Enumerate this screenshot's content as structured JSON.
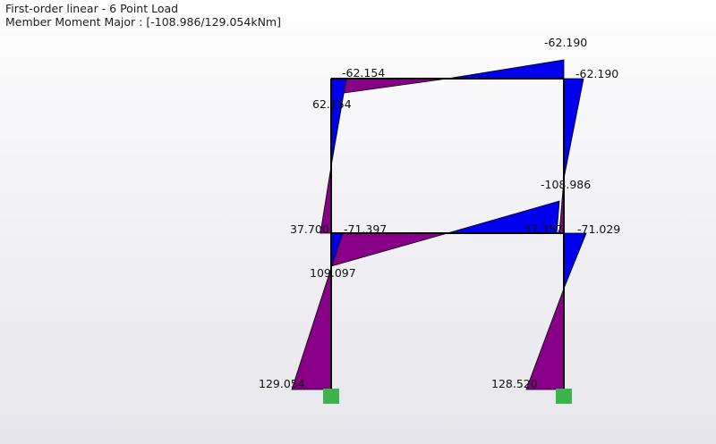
{
  "header": {
    "analysis": "First-order linear - 6 Point Load",
    "result": "Member Moment Major  : [-108.986/129.054kNm]"
  },
  "colors": {
    "positive": "#880088",
    "negative": "#0000ee",
    "support": "#3cb44b",
    "frame": "#000000"
  },
  "labels": {
    "top_beam_left": "-62.154",
    "top_beam_right_peak": "-62.190",
    "top_beam_right": "-62.190",
    "left_upper_col_top": "62.154",
    "right_upper_col_bottom": "-108.986",
    "left_upper_col_bottom": "37.700",
    "mid_beam_left": "-71.397",
    "mid_beam_right_end": "37.357",
    "mid_beam_right": "-71.029",
    "left_lower_col_top": "109.097",
    "left_base": "129.054",
    "right_base": "128.520"
  },
  "icons": {
    "left_support": "fixed-support-icon",
    "right_support": "fixed-support-icon"
  }
}
